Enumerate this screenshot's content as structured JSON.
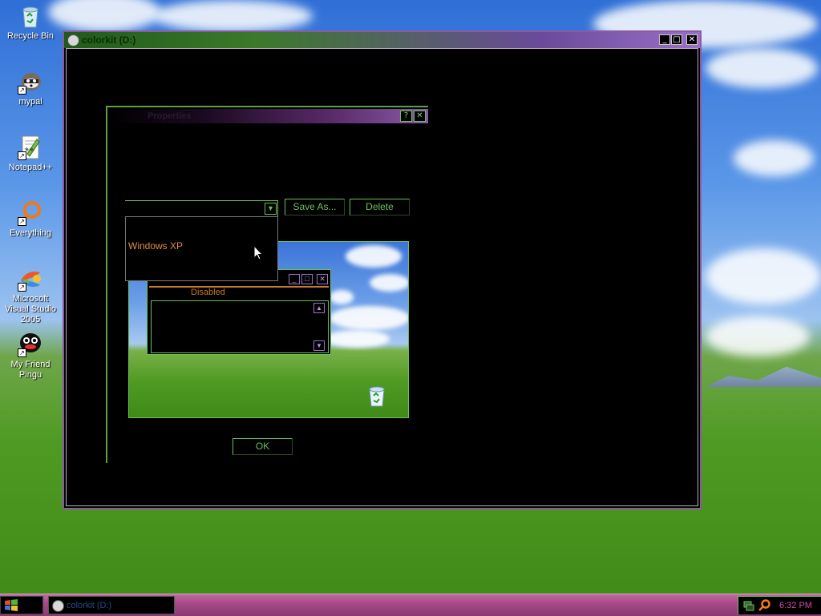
{
  "desktop": {
    "icons": [
      {
        "name": "recycle-bin",
        "label": "Recycle Bin"
      },
      {
        "name": "mypal",
        "label": "mypal"
      },
      {
        "name": "notepadpp",
        "label": "Notepad++"
      },
      {
        "name": "everything",
        "label": "Everything"
      },
      {
        "name": "msvs2005",
        "label": "Microsoft Visual Studio 2005"
      },
      {
        "name": "my-friend-pingu",
        "label": "My Friend Pingu"
      }
    ]
  },
  "main_window": {
    "title": "colorkit (D:)",
    "buttons": {
      "minimize": "_",
      "maximize": "□",
      "close": "✕"
    }
  },
  "dialog": {
    "title": "Properties",
    "buttons": {
      "help": "?",
      "close": "✕"
    },
    "scheme_selected": "",
    "save_as_label": "Save As...",
    "delete_label": "Delete",
    "dropdown_options": [
      "Windows XP"
    ],
    "ok_label": "OK"
  },
  "preview": {
    "window_buttons": {
      "minimize": "_",
      "maximize": "□",
      "close": "✕"
    },
    "disabled_label": "Disabled",
    "scroll_up": "▲",
    "scroll_down": "▼"
  },
  "taskbar": {
    "task_label": "colorkit (D:)",
    "clock": "6:32 PM"
  },
  "colors": {
    "accent_green": "#6ac05a",
    "accent_purple": "#a070c8",
    "accent_orange": "#e08a40",
    "taskbar_pink": "#a84a88"
  }
}
